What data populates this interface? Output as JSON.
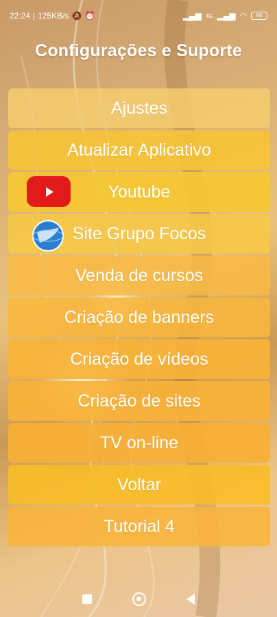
{
  "status_bar": {
    "time": "22:24",
    "speed": "125KB/s",
    "network": "4G",
    "battery": "96"
  },
  "header": {
    "title": "Configurações e Suporte"
  },
  "menu": {
    "items": [
      {
        "label": "Ajustes"
      },
      {
        "label": "Atualizar Aplicativo"
      },
      {
        "label": "Youtube",
        "icon": "youtube-icon"
      },
      {
        "label": "Site Grupo Focos",
        "icon": "globe-icon"
      },
      {
        "label": "Venda de cursos"
      },
      {
        "label": "Criação de banners"
      },
      {
        "label": "Criação de vídeos"
      },
      {
        "label": "Criação de sites"
      },
      {
        "label": "TV on-line"
      },
      {
        "label": "Voltar"
      },
      {
        "label": "Tutorial 4"
      }
    ]
  },
  "colors": {
    "youtube_red": "#e21a1a",
    "button_yellow": "#f7c434",
    "text": "#ffffff"
  }
}
